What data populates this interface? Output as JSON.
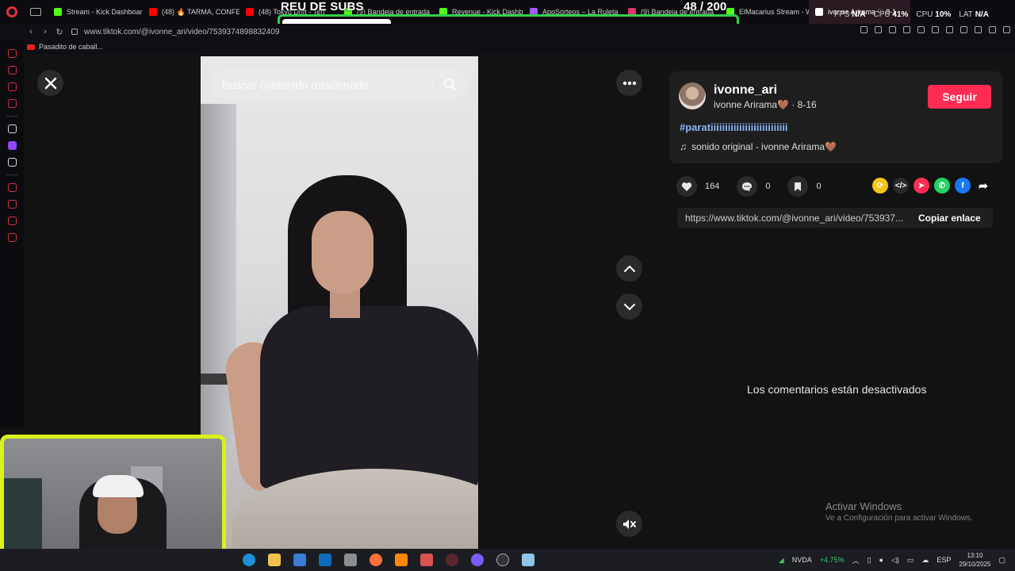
{
  "overlay": {
    "goal_label": "REU DE SUBS",
    "goal_count": "48 / 200",
    "goal_progress": 0.24,
    "fps_label": "FPS",
    "fps_value": "N/A",
    "cpu_obs_label": "CPU",
    "cpu_obs_value": "41%",
    "cpu_label": "CPU",
    "cpu_value": "10%",
    "lat_label": "LAT",
    "lat_value": "N/A"
  },
  "browser": {
    "tabs": [
      {
        "label": "Stream - Kick Dashboard",
        "color": "#53fc18"
      },
      {
        "label": "(48) 🔥 TARMA, CONFES",
        "color": "#ff0000"
      },
      {
        "label": "(48) Tokyo Drift - Terr",
        "color": "#ff0000"
      },
      {
        "label": "(9) Bandeja de entrada",
        "color": "#53fc18"
      },
      {
        "label": "Revenue - Kick Dashbo",
        "color": "#53fc18"
      },
      {
        "label": "AppSorteos – La Ruleta",
        "color": "#a05cff"
      },
      {
        "label": "(9) Bandeja de entrada",
        "color": "#e1306c"
      },
      {
        "label": "ElMacarius Stream - Wa",
        "color": "#53fc18"
      },
      {
        "label": "ivonne Arirama ♡ 8-1",
        "color": "#ffffff"
      }
    ],
    "url": "www.tiktok.com/@ivonne_ari/video/7539374898832409",
    "bookmark": "Pasadito de caball..."
  },
  "video": {
    "search_placeholder": "Buscar contenido relacionado"
  },
  "post": {
    "username": "ivonne_ari",
    "nickname": "ivonne Arirama🤎",
    "date": " · 8-16",
    "follow_label": "Seguir",
    "hashtag": "#paratiiiiiiiiiiiiiiiiiiiiiiiiiii",
    "sound": "sonido original - ivonne Arirama🤎",
    "likes": "164",
    "comments": "0",
    "saves": "0",
    "link": "https://www.tiktok.com/@ivonne_ari/video/753937...",
    "copy_label": "Copiar enlace",
    "comments_disabled": "Los comentarios están desactivados"
  },
  "windows": {
    "activate_title": "Activar Windows",
    "activate_sub": "Ve a Configuración para activar Windows."
  },
  "taskbar": {
    "stock_name": "NVDA",
    "stock_change": "+4.75%",
    "lang": "ESP",
    "time": "13:10",
    "date": "29/10/2025"
  }
}
